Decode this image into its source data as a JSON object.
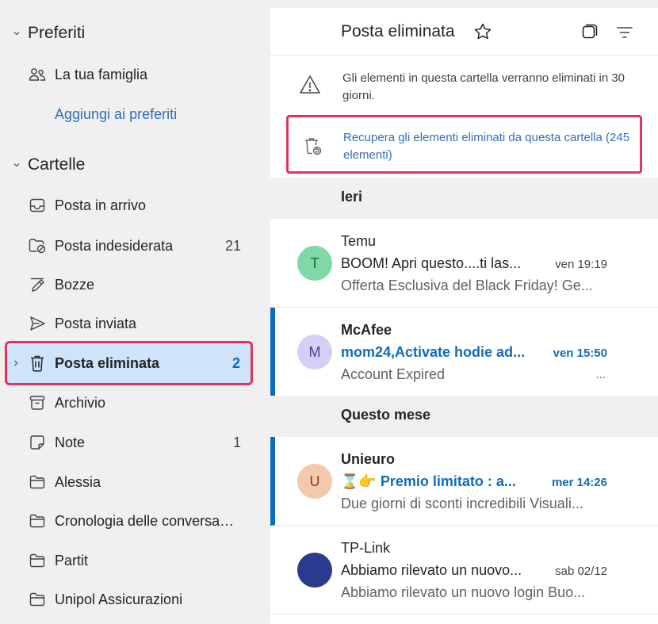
{
  "sidebar": {
    "favorites_header": "Preferiti",
    "favorites": [
      {
        "label": "La tua famiglia",
        "icon": "people-icon"
      },
      {
        "label": "Aggiungi ai preferiti"
      }
    ],
    "folders_header": "Cartelle",
    "folders": [
      {
        "label": "Posta in arrivo",
        "icon": "inbox-icon",
        "count": ""
      },
      {
        "label": "Posta indesiderata",
        "icon": "junk-icon",
        "count": "21"
      },
      {
        "label": "Bozze",
        "icon": "pencil-icon",
        "count": ""
      },
      {
        "label": "Posta inviata",
        "icon": "send-icon",
        "count": ""
      },
      {
        "label": "Posta eliminata",
        "icon": "trash-icon",
        "count": "2",
        "selected": true
      },
      {
        "label": "Archivio",
        "icon": "archive-icon",
        "count": ""
      },
      {
        "label": "Note",
        "icon": "note-icon",
        "count": "1"
      },
      {
        "label": "Alessia",
        "icon": "folder-icon",
        "count": ""
      },
      {
        "label": "Cronologia delle conversazioni",
        "icon": "folder-icon",
        "count": ""
      },
      {
        "label": "Partit",
        "icon": "folder-icon",
        "count": ""
      },
      {
        "label": "Unipol Assicurazioni",
        "icon": "folder-icon",
        "count": ""
      }
    ]
  },
  "pane": {
    "title": "Posta eliminata",
    "info_text": "Gli elementi in questa cartella verranno eliminati in 30 giorni.",
    "recover_text": "Recupera gli elementi eliminati da questa cartella (245 elementi)",
    "groups": [
      "Ieri",
      "Questo mese"
    ],
    "messages": [
      {
        "initial": "T",
        "avatar_bg": "#7fd8a8",
        "avatar_fg": "#0e6b3d",
        "sender": "Temu",
        "subject": "BOOM! Apri questo....ti las...",
        "time": "ven 19:19",
        "preview": "Offerta Esclusiva del Black Friday! Ge...",
        "unread": false
      },
      {
        "initial": "M",
        "avatar_bg": "#d4d0f5",
        "avatar_fg": "#4b3c99",
        "sender": "McAfee",
        "subject": "mom24,Activate hodie ad...",
        "time": "ven 15:50",
        "preview": "Account Expired",
        "unread": true,
        "extra": "..."
      },
      {
        "initial": "U",
        "avatar_bg": "#f2c9ad",
        "avatar_fg": "#8a3b12",
        "sender": "Unieuro",
        "subject": "⌛👉 Premio limitato : a...",
        "time": "mer 14:26",
        "preview": "Due giorni di sconti incredibili Visuali...",
        "unread": true
      },
      {
        "initial": "",
        "avatar_bg": "#2a3b8f",
        "avatar_fg": "#ffffff",
        "sender": "TP-Link",
        "subject": "Abbiamo rilevato un nuovo...",
        "time": "sab 02/12",
        "preview": "Abbiamo rilevato un nuovo login Buo...",
        "unread": false
      }
    ]
  },
  "colors": {
    "accent": "#0f6cbd",
    "highlight": "#e0345c",
    "selected_bg": "#cfe4fa"
  }
}
